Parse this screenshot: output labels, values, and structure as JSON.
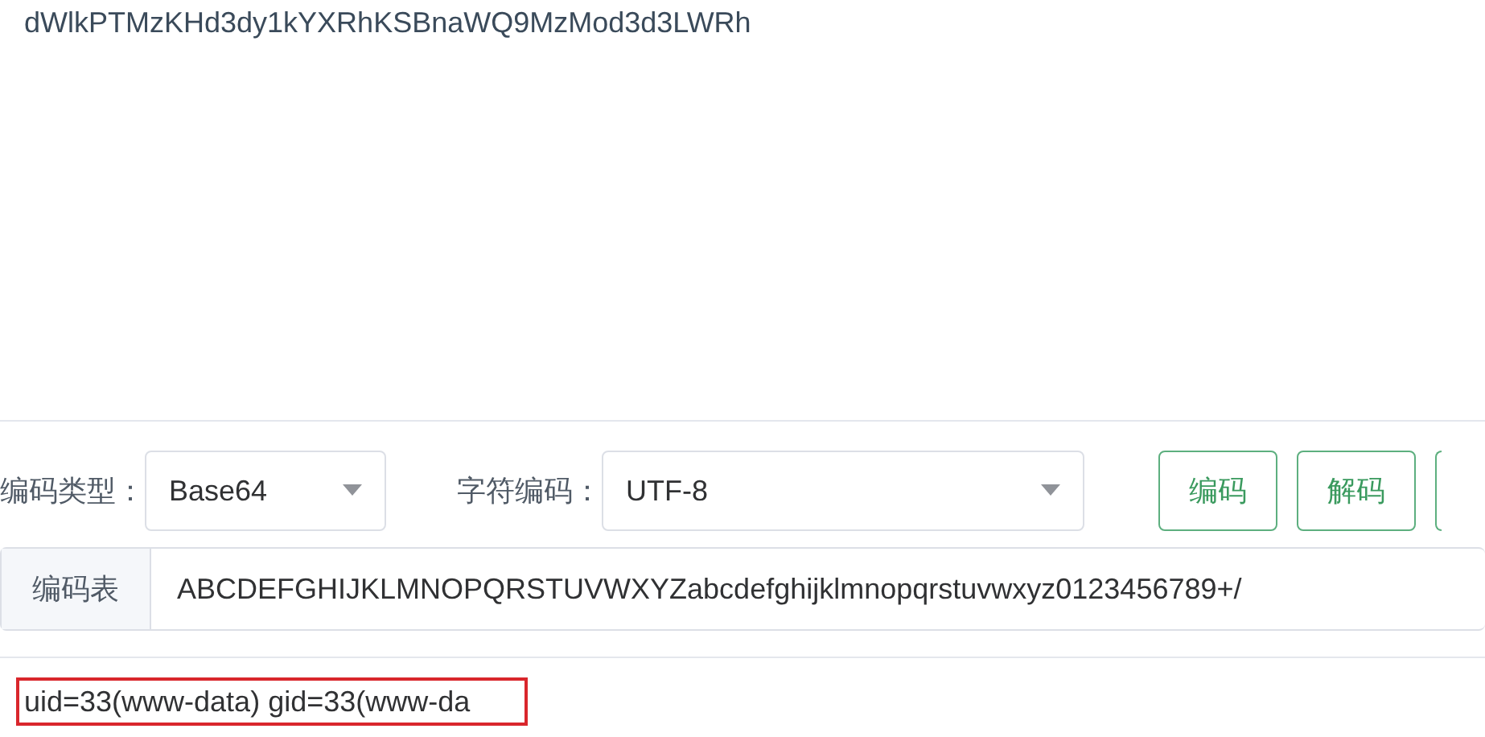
{
  "input_text": "dWlkPTMzKHd3dy1kYXRhKSBnaWQ9MzMod3d3LWRh",
  "encoding_type": {
    "label": "编码类型：",
    "value": "Base64"
  },
  "charset": {
    "label": "字符编码：",
    "value": "UTF-8"
  },
  "buttons": [
    "编码",
    "解码"
  ],
  "alphabet": {
    "label": "编码表",
    "value": "ABCDEFGHIJKLMNOPQRSTUVWXYZabcdefghijklmnopqrstuvwxyz0123456789+/"
  },
  "output_text": "uid=33(www-data) gid=33(www-da"
}
